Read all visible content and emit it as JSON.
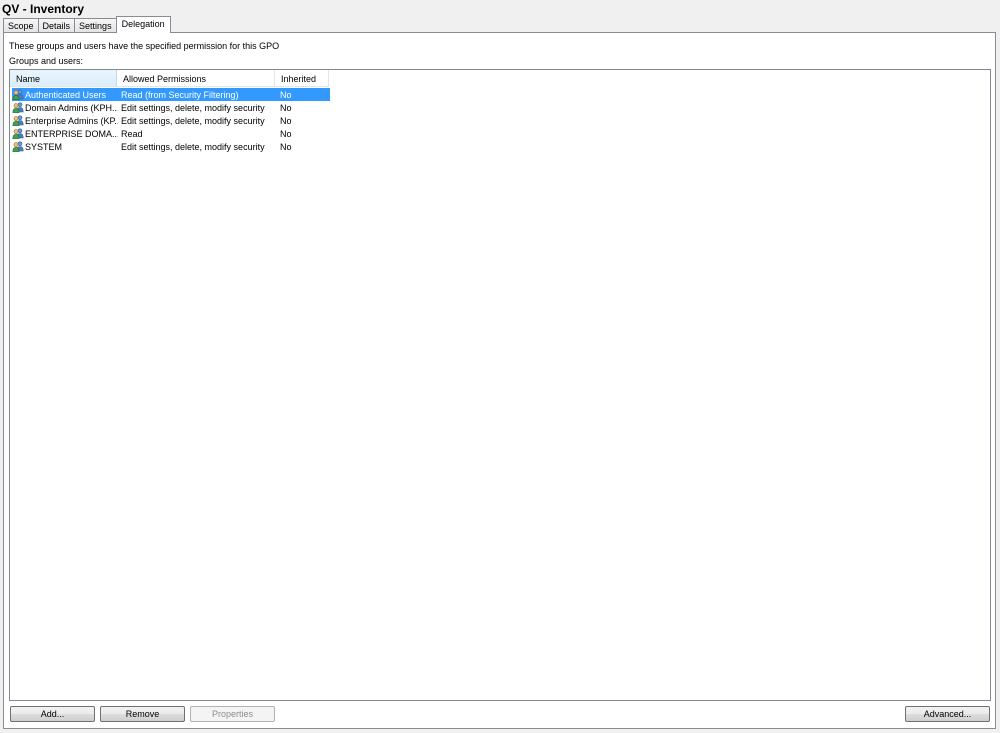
{
  "window": {
    "title": "QV - Inventory"
  },
  "tabs": [
    {
      "label": "Scope",
      "active": false
    },
    {
      "label": "Details",
      "active": false
    },
    {
      "label": "Settings",
      "active": false
    },
    {
      "label": "Delegation",
      "active": true
    }
  ],
  "delegation": {
    "description": "These groups and users have the specified permission for this GPO",
    "groups_label": "Groups and users:",
    "columns": {
      "name": "Name",
      "permissions": "Allowed Permissions",
      "inherited": "Inherited"
    },
    "sort_indicator": "^",
    "rows": [
      {
        "name": "Authenticated Users",
        "permissions": "Read (from Security Filtering)",
        "inherited": "No",
        "selected": true,
        "icon": "user-group-icon"
      },
      {
        "name": "Domain Admins (KPH...",
        "permissions": "Edit settings, delete, modify security",
        "inherited": "No",
        "selected": false,
        "icon": "user-group-icon"
      },
      {
        "name": "Enterprise Admins (KP...",
        "permissions": "Edit settings, delete, modify security",
        "inherited": "No",
        "selected": false,
        "icon": "user-group-icon"
      },
      {
        "name": "ENTERPRISE DOMA...",
        "permissions": "Read",
        "inherited": "No",
        "selected": false,
        "icon": "user-group-icon"
      },
      {
        "name": "SYSTEM",
        "permissions": "Edit settings, delete, modify security",
        "inherited": "No",
        "selected": false,
        "icon": "user-group-icon"
      }
    ],
    "buttons": {
      "add": "Add...",
      "remove": "Remove",
      "properties": "Properties",
      "advanced": "Advanced..."
    }
  },
  "colors": {
    "selection": "#3399ff",
    "border": "#898c95",
    "background": "#f0f0f0"
  }
}
